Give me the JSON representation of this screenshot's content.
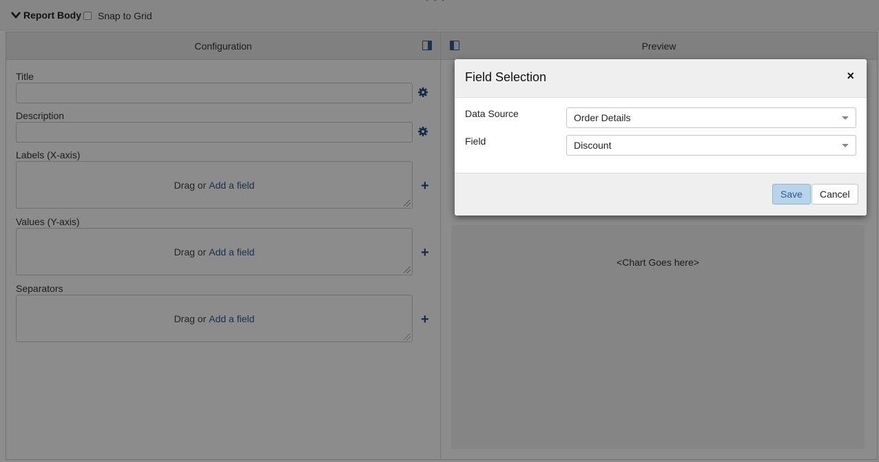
{
  "top": {
    "section_label": "Report Body",
    "snap_label": "Snap to Grid"
  },
  "config": {
    "header": "Configuration",
    "title_label": "Title",
    "description_label": "Description",
    "labels_label": "Labels (X-axis)",
    "values_label": "Values (Y-axis)",
    "separators_label": "Separators",
    "drag_text": "Drag or",
    "add_link": "Add a field"
  },
  "preview": {
    "header": "Preview",
    "placeholder": "<Chart Goes here>"
  },
  "modal": {
    "title": "Field Selection",
    "close": "×",
    "data_source_label": "Data Source",
    "data_source_value": "Order Details",
    "field_label": "Field",
    "field_value": "Discount",
    "save_label": "Save",
    "cancel_label": "Cancel"
  },
  "colors": {
    "accent": "#2f5d93",
    "link": "#2a5a8e",
    "save_bg": "#b8d4ea"
  }
}
